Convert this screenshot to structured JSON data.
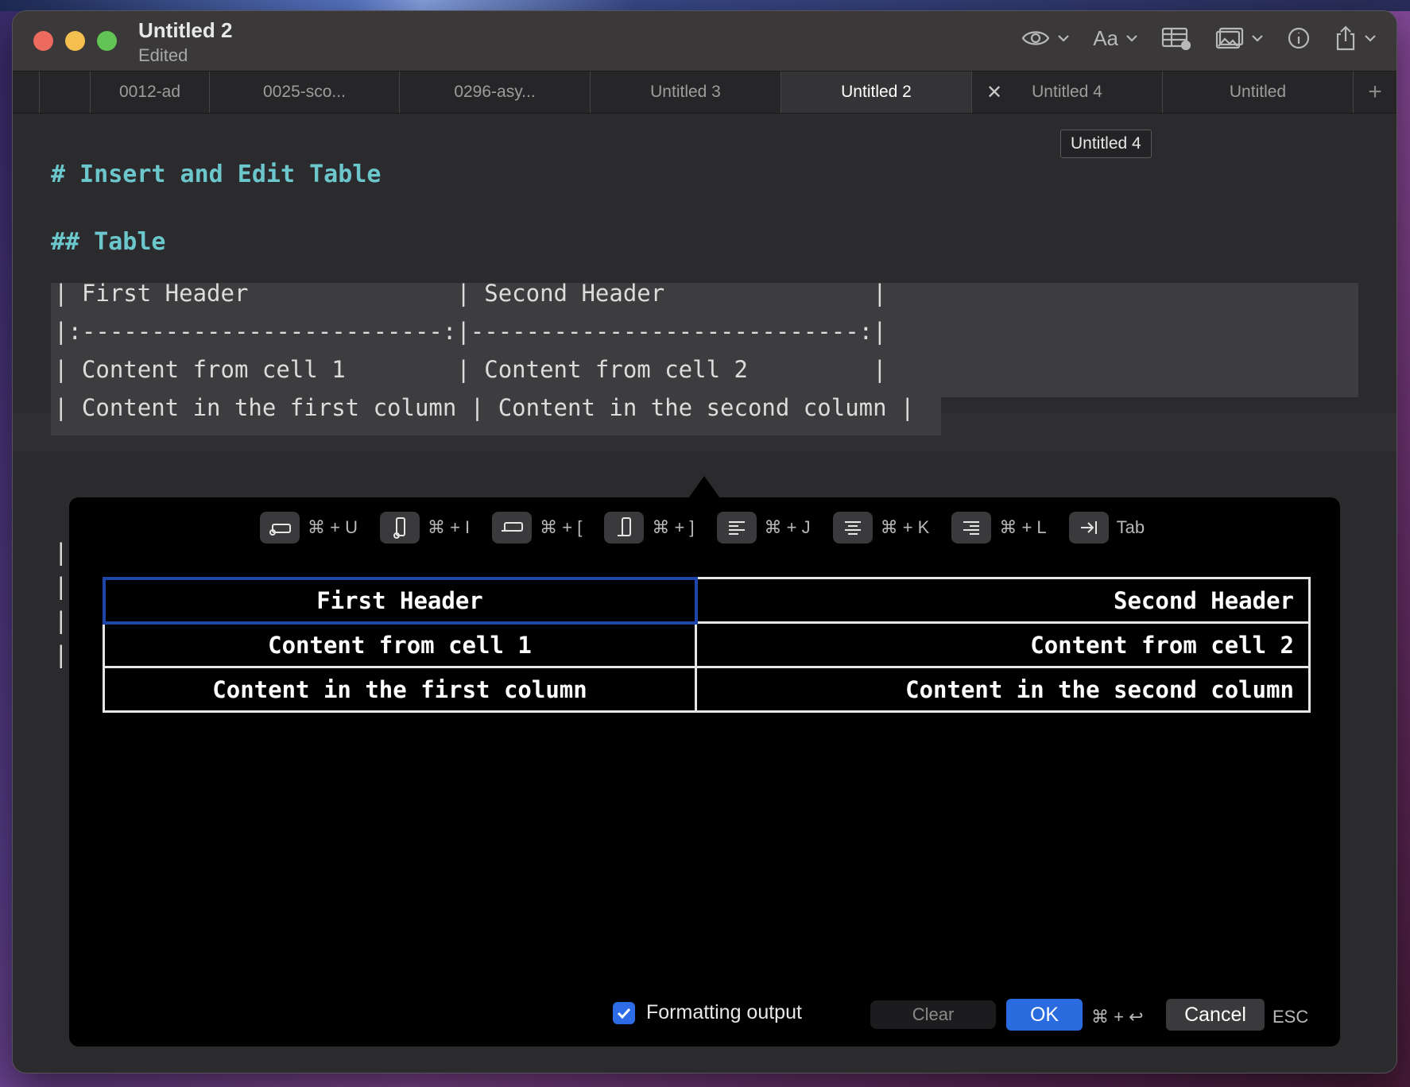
{
  "window": {
    "title": "Untitled 2",
    "subtitle": "Edited"
  },
  "toolbar": {
    "font_label": "Aa"
  },
  "tabs": [
    {
      "label": "",
      "width": 98
    },
    {
      "label": "0012-ad",
      "width": 150
    },
    {
      "label": "0025-sco...",
      "width": 239
    },
    {
      "label": "0296-asy...",
      "width": 240
    },
    {
      "label": "Untitled 3",
      "width": 240
    },
    {
      "label": "Untitled 2",
      "width": 240,
      "active": true
    },
    {
      "label": "Untitled 4",
      "width": 240,
      "close": true
    },
    {
      "label": "Untitled",
      "width": 240
    }
  ],
  "tooltip": "Untitled 4",
  "editor": {
    "h1": "# Insert and Edit Table",
    "h2": "## Table",
    "lines": [
      "| First Header               | Second Header               |",
      "|:--------------------------:|----------------------------:|",
      "| Content from cell 1        | Content from cell 2         |",
      "| Content in the first column | Content in the second column |"
    ],
    "trailing_bars": [
      "|",
      "|",
      "|",
      "|"
    ]
  },
  "popover": {
    "shortcuts": [
      {
        "icon": "insert-row-above-icon",
        "label": "⌘ + U"
      },
      {
        "icon": "insert-column-left-icon",
        "label": "⌘ + I"
      },
      {
        "icon": "delete-row-icon",
        "label": "⌘ + ["
      },
      {
        "icon": "delete-column-icon",
        "label": "⌘ + ]"
      },
      {
        "icon": "align-left-icon",
        "label": "⌘ + J"
      },
      {
        "icon": "align-center-icon",
        "label": "⌘ + K"
      },
      {
        "icon": "align-right-icon",
        "label": "⌘ + L"
      },
      {
        "icon": "tab-arrow-icon",
        "label": "Tab"
      }
    ],
    "table": [
      [
        "First Header",
        "Second Header"
      ],
      [
        "Content from cell 1",
        "Content from cell 2"
      ],
      [
        "Content in the first column",
        "Content in the second column"
      ]
    ],
    "formatting_label": "Formatting output",
    "formatting_checked": true,
    "clear_label": "Clear",
    "ok_label": "OK",
    "ok_shortcut": "⌘ + ↩",
    "cancel_label": "Cancel",
    "cancel_shortcut": "ESC"
  }
}
